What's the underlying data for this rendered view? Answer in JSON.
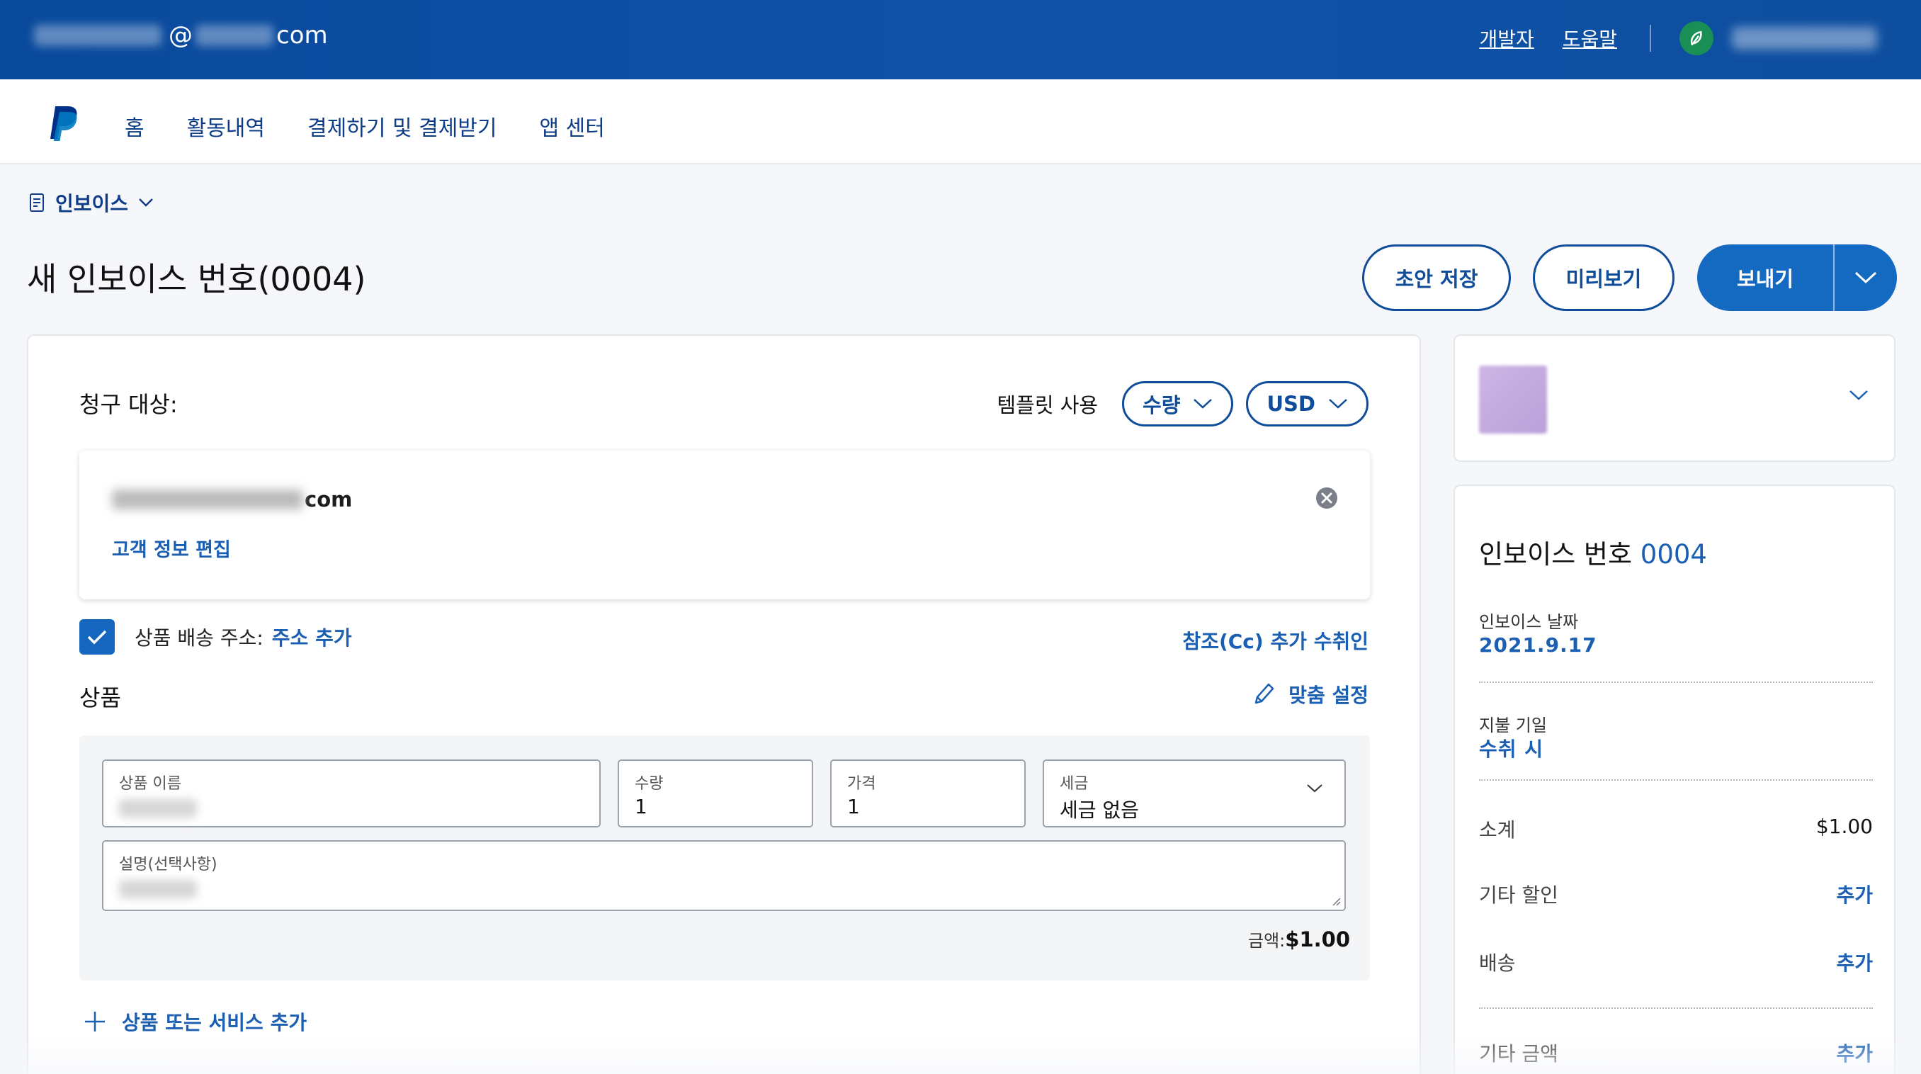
{
  "topbar": {
    "email_suffix": "com",
    "email_at": "@",
    "links": [
      "개발자",
      "도움말"
    ]
  },
  "nav": {
    "items": [
      "홈",
      "활동내역",
      "결제하기 및 결제받기",
      "앱 센터"
    ]
  },
  "breadcrumb": {
    "label": "인보이스"
  },
  "page": {
    "title_main": "새 인보이스 번호",
    "title_num": "(0004)",
    "draft_label": "초안 저장",
    "preview_label": "미리보기",
    "send_label": "보내기"
  },
  "bill": {
    "label": "청구 대상:",
    "template_label": "템플릿 사용",
    "template_select": "수량",
    "currency_select": "USD",
    "customer_email_suffix": "com",
    "edit_link": "고객 정보 편집",
    "ship_label": "상품 배송 주소:",
    "ship_add": "주소 추가",
    "cc_link": "참조(Cc) 추가 수취인"
  },
  "items": {
    "label": "상품",
    "custom_label": "맞춤 설정",
    "name_label": "상품 이름",
    "qty_label": "수량",
    "qty_value": "1",
    "price_label": "가격",
    "price_value": "1",
    "tax_label": "세금",
    "tax_value": "세금 없음",
    "desc_label": "설명(선택사항)",
    "amount_label": "금액:",
    "amount_value": "$1.00",
    "add_item": "상품 또는 서비스 추가"
  },
  "summary": {
    "title": "인보이스 번호",
    "number": "0004",
    "date_label": "인보이스 날짜",
    "date_value": "2021.9.17",
    "due_label": "지불 기일",
    "due_value": "수취 시",
    "subtotal_label": "소계",
    "subtotal_value": "$1.00",
    "discount_label": "기타 할인",
    "discount_action": "추가",
    "shipping_label": "배송",
    "shipping_action": "추가",
    "other_label": "기타 금액",
    "other_action": "추가"
  },
  "colors": {
    "topbar": "#0f52a8",
    "primary": "#1469c0",
    "link": "#1b5fb3",
    "nav_text": "#0d3c88"
  }
}
